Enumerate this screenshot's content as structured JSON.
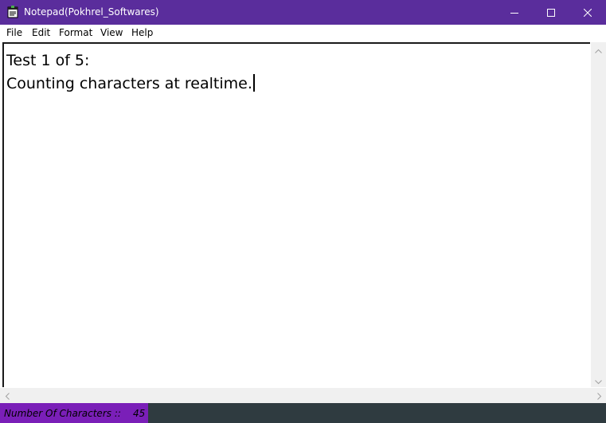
{
  "window": {
    "title": "Notepad(Pokhrel_Softwares)",
    "titlebar_color": "#5a2d9c",
    "icons": {
      "app": "notepad-app-icon",
      "minimize": "minimize-icon",
      "maximize": "maximize-icon",
      "close": "close-icon"
    }
  },
  "menu": {
    "file": "File",
    "edit": "Edit",
    "format": "Format",
    "view": "View",
    "help": "Help"
  },
  "editor": {
    "line1": "Test 1 of 5:",
    "line2": "Counting characters at realtime."
  },
  "status": {
    "label": "Number Of Characters ::",
    "count": "45",
    "label_bg_color": "#7a1fb8",
    "bar_color": "#2f3b40"
  }
}
